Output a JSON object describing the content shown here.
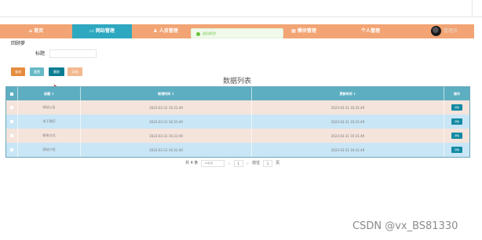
{
  "nav": {
    "items": [
      {
        "label": "首页",
        "icon": "home-icon"
      },
      {
        "label": "网站管理",
        "icon": "monitor-icon"
      },
      {
        "label": "人员管理",
        "icon": "person-icon"
      },
      {
        "label": "模块管理",
        "icon": "module-icon"
      },
      {
        "label": "个人管理",
        "icon": "user-icon"
      }
    ],
    "active_index": 1,
    "active_color": "#2ea8c0",
    "bar_color": "#f2a474",
    "user_name": "管理员"
  },
  "toast": {
    "text": "退出成功!"
  },
  "breadcrumb": "回顾萝",
  "search": {
    "label": "标题",
    "value": "",
    "placeholder": ""
  },
  "buttons": {
    "search": "查询",
    "reset": "重置",
    "delete": "删除",
    "add": "添加"
  },
  "table": {
    "title": "数据列表",
    "headers": [
      "标题 ↕",
      "新增时间 ↕",
      "更新时间 ↕",
      "操作"
    ],
    "rows": [
      {
        "title": "网站公告",
        "created": "2023-03-31 16:31:49",
        "updated": "2023-03-31 16:31:49",
        "action": "详情"
      },
      {
        "title": "关于我们",
        "created": "2023-03-31 16:31:49",
        "updated": "2023-03-31 16:31:49",
        "action": "详情"
      },
      {
        "title": "联系方式",
        "created": "2023-03-31 16:31:49",
        "updated": "2023-03-31 16:31:49",
        "action": "详情"
      },
      {
        "title": "网站介绍",
        "created": "2023-03-31 16:31:49",
        "updated": "2023-03-31 16:31:49",
        "action": "详情"
      }
    ]
  },
  "pager": {
    "total": "共 4 条",
    "page_size": "10条/页",
    "prev": "<",
    "current": "1",
    "next": ">",
    "goto_label": "前往",
    "goto_value": "1",
    "page_unit": "页"
  },
  "watermark": "CSDN @vx_BS81330"
}
